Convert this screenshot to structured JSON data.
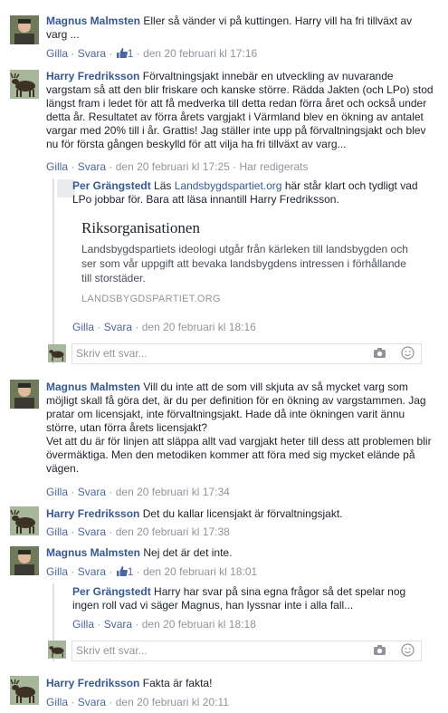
{
  "comments": [
    {
      "author": "Magnus Malmsten",
      "text": "Eller så vänder vi på kuttingen. Harry vill ha fri tillväxt av varg ...",
      "like": "Gilla",
      "reply": "Svara",
      "likes": "1",
      "time": "den 20 februari kl 17:16"
    },
    {
      "author": "Harry Fredriksson",
      "text": "Förvaltningsjakt innebär en utveckling av nuvarande vargstam så att den blir friskare och kanske större. Rädda Jakten (och LPo) stod längst fram i ledet för att få medverka till detta redan förra året och också under detta år. Resultatet av förra årets vargjakt i Värmland blev en ökning av antalet vargar med 20% till i år. Grattis! Jag ställer inte upp på förvaltningsjakt och blev nu för första gången beskylld för att vilja ha fri tillväxt av varg...",
      "like": "Gilla",
      "reply": "Svara",
      "time": "den 20 februari kl 17:25",
      "edited": "Har redigerats"
    },
    {
      "author": "Magnus Malmsten",
      "text": "Vill du inte att de som vill skjuta av så mycket varg som möjligt skall få göra det, är du per definition för en ökning av vargstammen. Jag pratar om licensjakt, inte förvaltningsjakt. Hade då inte ökningen varit ännu större, utan förra årets licensjakt?\nVet att du är för linjen att släppa allt vad vargjakt heter till dess att problemen blir övermäktiga. Men den metodiken kommer att föra med sig mycket elände på vägen.",
      "like": "Gilla",
      "reply": "Svara",
      "time": "den 20 februari kl 17:34"
    },
    {
      "author": "Harry Fredriksson",
      "text": "Det du kallar licensjakt är förvaltningsjakt.",
      "like": "Gilla",
      "reply": "Svara",
      "time": "den 20 februari kl 17:38"
    },
    {
      "author": "Magnus Malmsten",
      "text": "Nej det är det inte.",
      "like": "Gilla",
      "reply": "Svara",
      "likes": "1",
      "time": "den 20 februari kl 18:01"
    },
    {
      "author": "Harry Fredriksson",
      "text": "Fakta är fakta!",
      "like": "Gilla",
      "reply": "Svara",
      "time": "den 20 februari kl 20:11"
    }
  ],
  "replies": [
    {
      "author": "Per Grängstedt",
      "pre": "Läs ",
      "link": "Landsbygdspartiet.org",
      "post": " här står klart och tydligt vad LPo jobbar för. Bara att läsa innantill Harry Fredriksson.",
      "preview": {
        "title": "Riksorganisationen",
        "desc": "Landsbygdspartiets ideologi utgår från kärleken till landsbygden och ser som vår uppgift att bevaka landsbygdens intressen i förhållande till storstäder.",
        "domain": "LANDSBYGDSPARTIET.ORG"
      },
      "like": "Gilla",
      "reply": "Svara",
      "time": "den 20 februari kl 18:16"
    },
    {
      "author": "Per Grängstedt",
      "text": "Harry har svar på sina egna frågor så det spelar nog ingen roll vad vi säger Magnus, han lyssnar inte i alla fall...",
      "like": "Gilla",
      "reply": "Svara",
      "time": "den 20 februari kl 18:18"
    }
  ],
  "reply_box": {
    "placeholder": "Skriv ett svar..."
  },
  "colors": {
    "link": "#365899",
    "meta": "#90949c",
    "border": "#dddfe2"
  }
}
